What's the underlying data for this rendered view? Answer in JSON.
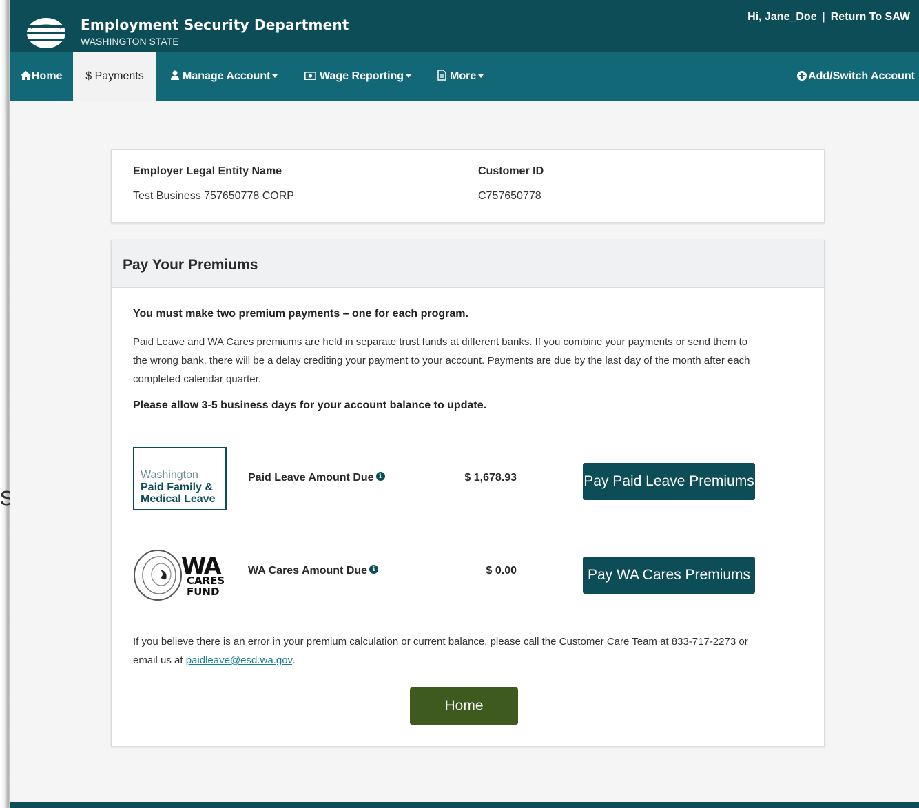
{
  "header": {
    "title": "Employment Security Department",
    "subtitle": "WASHINGTON STATE",
    "greeting": "Hi, Jane_Doe",
    "separator": "|",
    "return_link": "Return To SAW"
  },
  "nav": {
    "home": "Home",
    "payments": "$ Payments",
    "manage_account": "Manage Account",
    "wage_reporting": "Wage Reporting",
    "more": "More",
    "add_switch": "Add/Switch Account"
  },
  "employer": {
    "name_label": "Employer Legal Entity Name",
    "name_value": "Test Business 757650778 CORP",
    "id_label": "Customer ID",
    "id_value": "C757650778"
  },
  "premiums": {
    "title": "Pay Your Premiums",
    "intro_bold": "You must make two premium payments – one for each program.",
    "body": "Paid Leave and WA Cares premiums are held in separate trust funds at different banks. If you combine your payments or send them to the wrong bank, there will be a delay crediting your payment to your account. Payments are due by the last day of the month after each completed calendar quarter.",
    "allow_note": "Please allow 3-5 business days for your account balance to update.",
    "paid_leave": {
      "logo_line1": "Washington",
      "logo_line2": "Paid Family &",
      "logo_line3": "Medical Leave",
      "label": "Paid Leave Amount Due",
      "amount": "$ 1,678.93",
      "button": "Pay Paid Leave Premiums"
    },
    "wa_cares": {
      "logo_wa": "WA",
      "logo_cares": "CARES",
      "logo_fund": "FUND",
      "label": "WA Cares Amount Due",
      "amount": "$ 0.00",
      "button": "Pay WA Cares Premiums"
    },
    "help_text_1": "If you believe there is an error in your premium calculation or current balance, please call the Customer Care Team at 833-717-2273 or",
    "help_text_2": "email us at",
    "help_email": "paidleave@esd.wa.gov",
    "help_text_3": ".",
    "home_button": "Home"
  },
  "icons": {
    "info": "info-circle-icon",
    "home": "home-icon",
    "user": "user-icon",
    "wage": "money-icon",
    "more": "document-icon",
    "add": "plus-circle-icon"
  },
  "colors": {
    "header_bg": "#0d4d57",
    "nav_bg": "#126877",
    "button_primary": "#0d4d57",
    "button_home": "#3f5a1f",
    "page_bg": "#f5f5f5"
  }
}
